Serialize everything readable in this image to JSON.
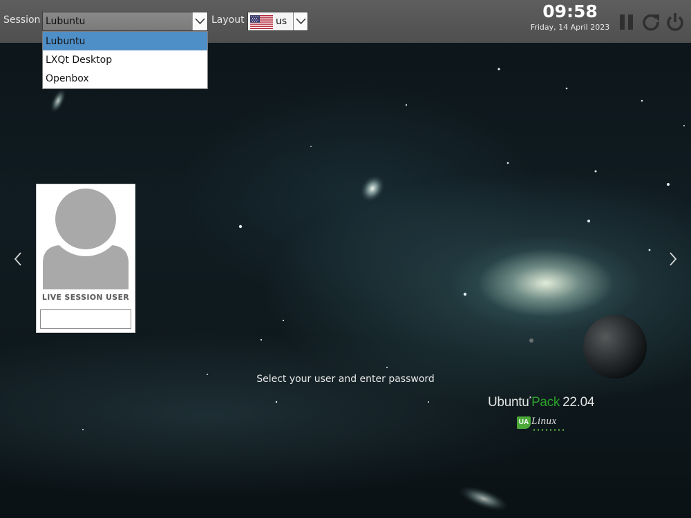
{
  "topbar": {
    "session_label": "Session",
    "session_value": "Lubuntu",
    "layout_label": "Layout",
    "layout_value": "us",
    "session_options": [
      "Lubuntu",
      "LXQt Desktop",
      "Openbox"
    ],
    "selected_option": "Lubuntu",
    "time": "09:58",
    "date": "Friday, 14 April 2023",
    "power_buttons": [
      "suspend-icon",
      "restart-icon",
      "shutdown-icon"
    ]
  },
  "user": {
    "name": "LIVE SESSION USER",
    "password_value": ""
  },
  "prompt": "Select your user and enter password",
  "branding": {
    "name_part1": "Ubuntu",
    "superscript": "*",
    "name_part2": "Pack",
    "version": "22.04",
    "badge": "UA",
    "sub": "Linux"
  },
  "colors": {
    "topbar": "#555555",
    "selected_item": "#4f8fc8",
    "brand_green": "#2aa12a"
  }
}
